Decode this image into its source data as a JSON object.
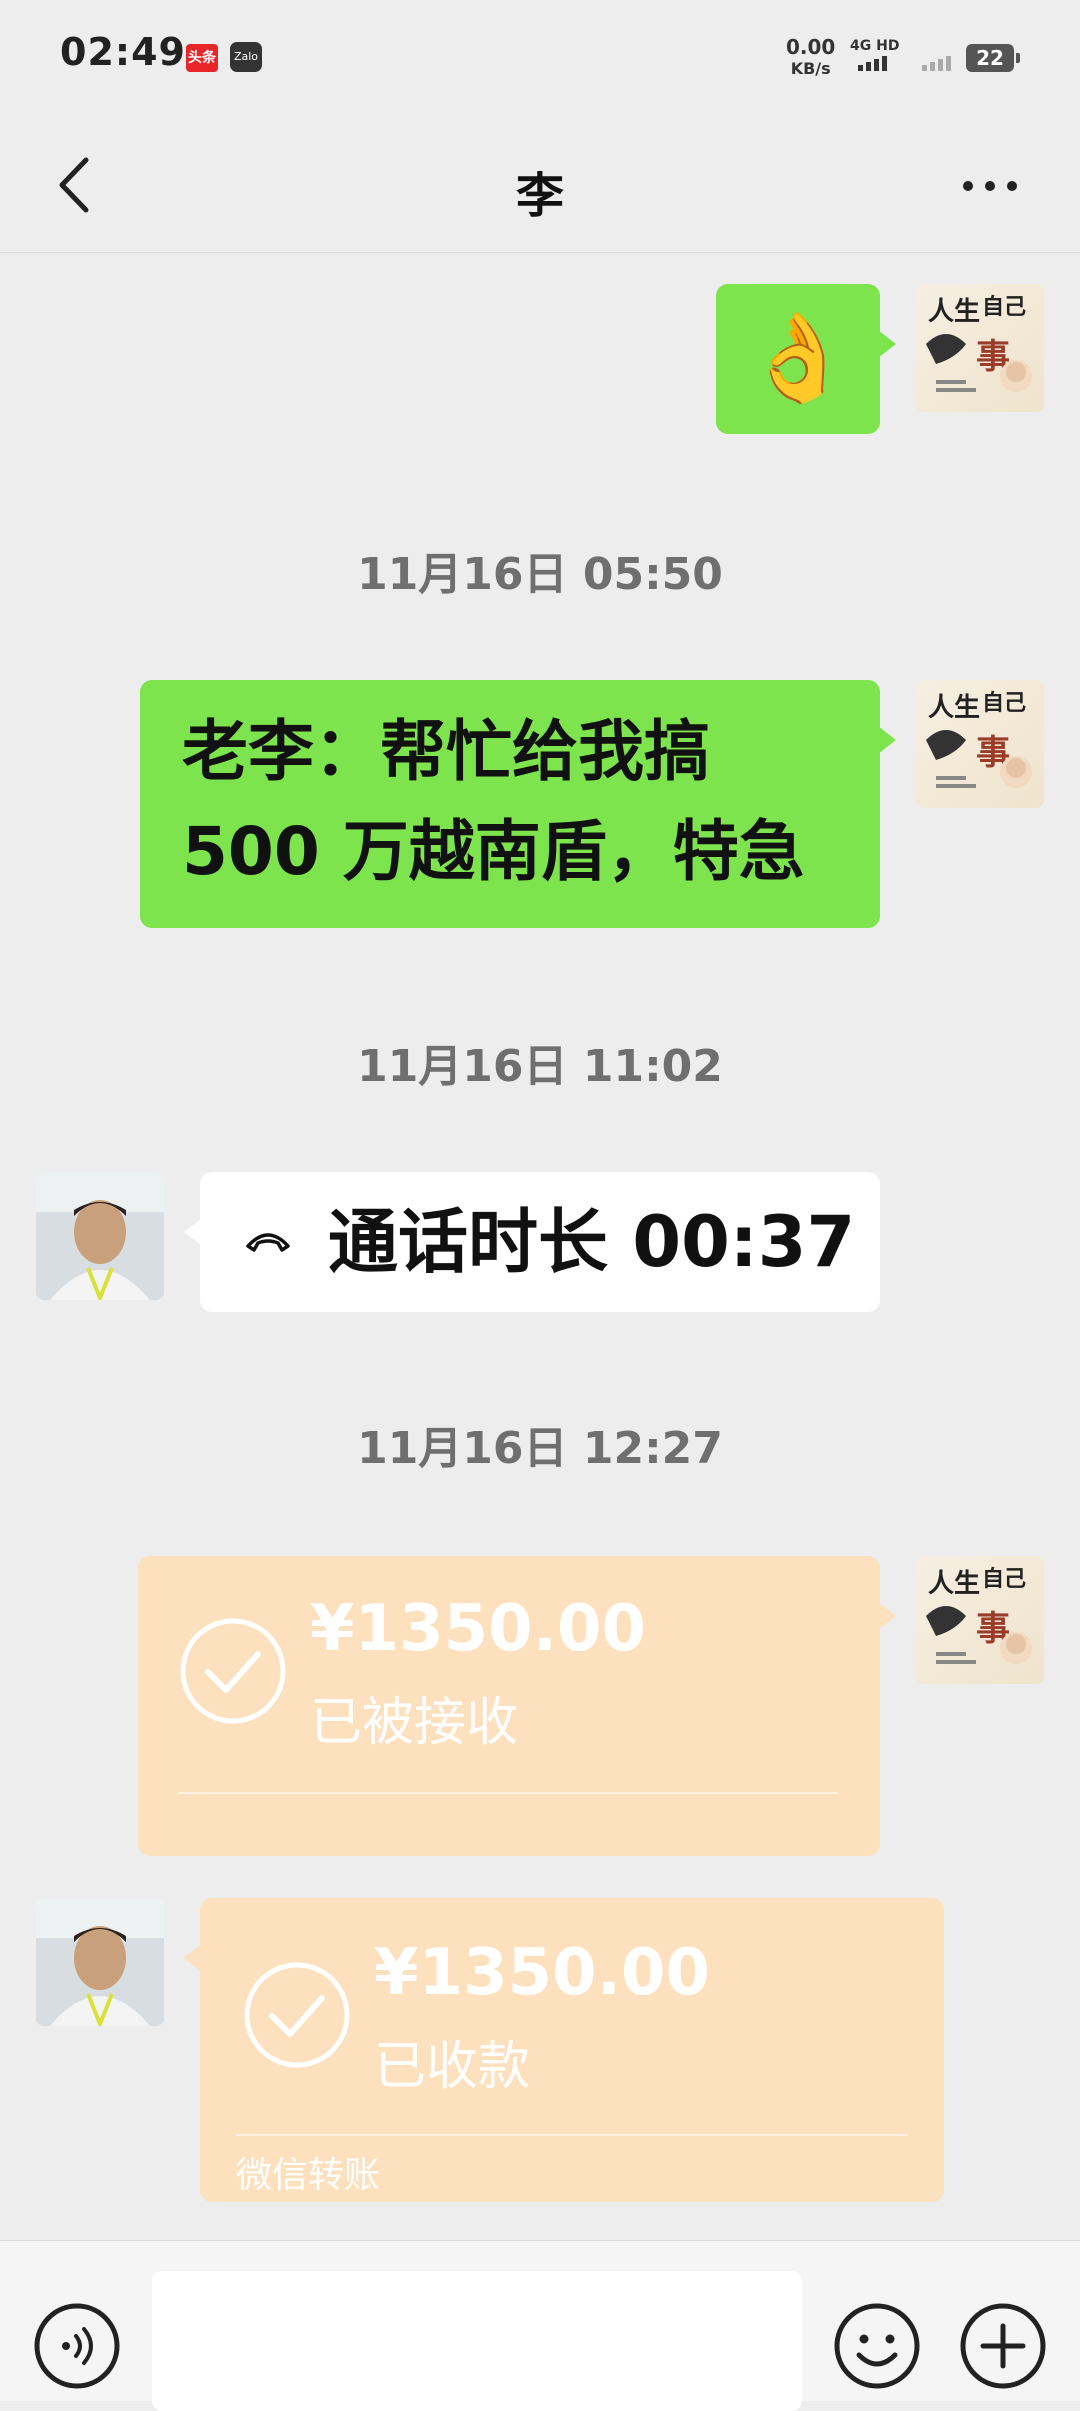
{
  "status_bar": {
    "time": "02:49",
    "app_icon_1": "头条",
    "app_icon_2": "Zalo",
    "net_speed_value": "0.00",
    "net_speed_unit": "KB/s",
    "network": "4G HD",
    "battery": "22"
  },
  "header": {
    "title": "李",
    "back_icon": "chevron-left-icon",
    "more_icon": "more-dots-icon"
  },
  "messages": [
    {
      "type": "emoji",
      "direction": "out",
      "content": "👌"
    },
    {
      "type": "timestamp",
      "text": "11月16日 05:50"
    },
    {
      "type": "text",
      "direction": "out",
      "lines": [
        "老李：帮忙给我搞",
        "500 万越南盾，特急"
      ]
    },
    {
      "type": "timestamp",
      "text": "11月16日 11:02"
    },
    {
      "type": "call",
      "direction": "in",
      "text": "通话时长 00:37",
      "icon": "phone-hangup-icon"
    },
    {
      "type": "timestamp",
      "text": "11月16日 12:27"
    },
    {
      "type": "transfer",
      "direction": "out",
      "amount": "¥1350.00",
      "status": "已被接收",
      "icon": "check-circle-icon"
    },
    {
      "type": "transfer",
      "direction": "in",
      "amount": "¥1350.00",
      "status": "已收款",
      "label": "微信转账",
      "icon": "check-circle-icon"
    }
  ],
  "bottom_bar": {
    "voice_icon": "voice-icon",
    "emoji_icon": "emoji-icon",
    "plus_icon": "plus-icon",
    "input_value": ""
  },
  "colors": {
    "background": "#ededed",
    "bubble_green": "#7ee44e",
    "bubble_white": "#ffffff",
    "transfer_orange": "#fde0bd"
  }
}
